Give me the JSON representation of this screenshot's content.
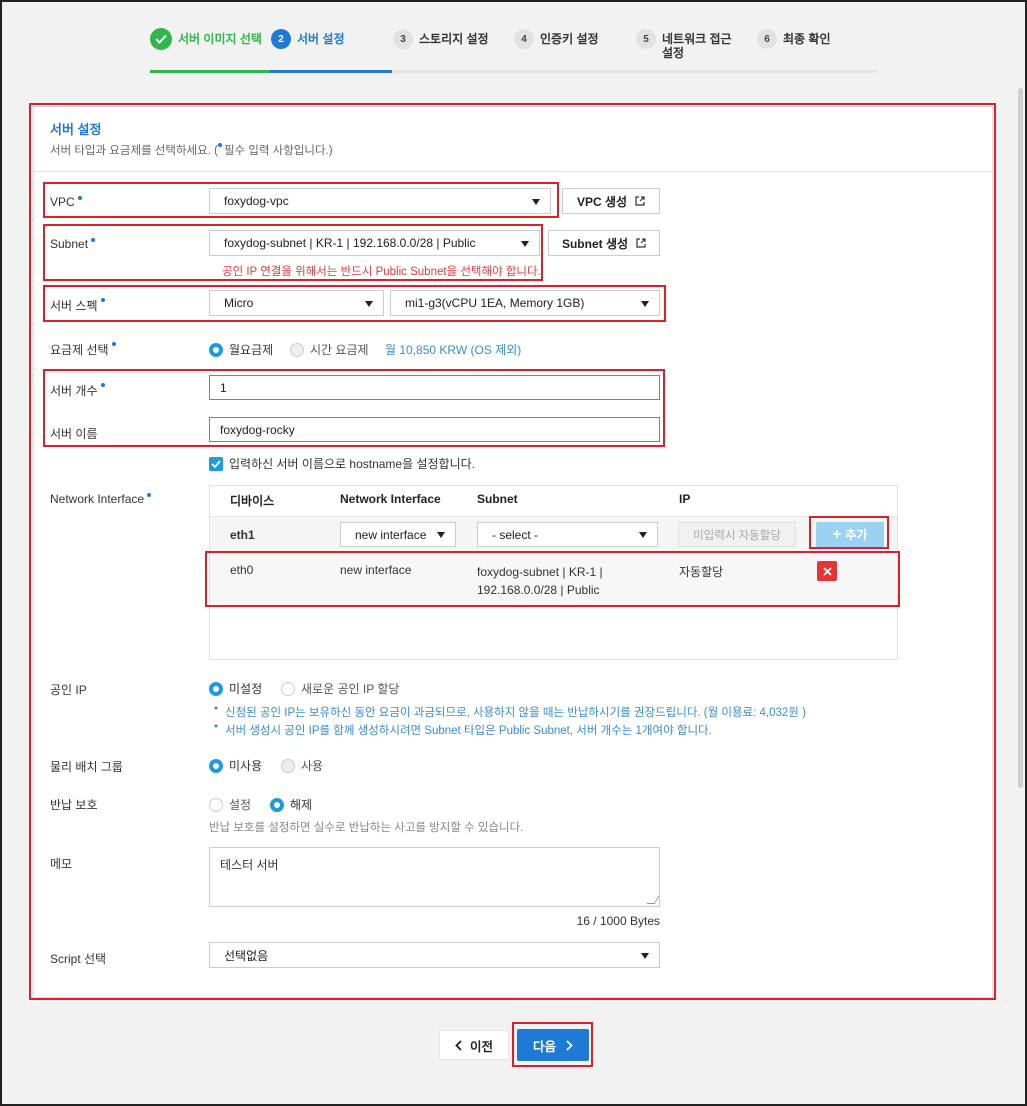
{
  "stepper": {
    "steps": [
      {
        "num": "",
        "label": "서버 이미지 선택"
      },
      {
        "num": "2",
        "label": "서버 설정"
      },
      {
        "num": "3",
        "label": "스토리지 설정"
      },
      {
        "num": "4",
        "label": "인증키 설정"
      },
      {
        "num": "5",
        "label": "네트워크 접근 설정"
      },
      {
        "num": "6",
        "label": "최종 확인"
      }
    ]
  },
  "panel": {
    "title": "서버 설정",
    "subtitle_prefix": "서버 타입과 요금제를 선택하세요. (",
    "subtitle_suffix": "필수 입력 사항입니다.)"
  },
  "vpc": {
    "label": "VPC",
    "value": "foxydog-vpc",
    "create_button": "VPC 생성"
  },
  "subnet": {
    "label": "Subnet",
    "value": "foxydog-subnet | KR-1 | 192.168.0.0/28 | Public",
    "create_button": "Subnet 생성",
    "warning": "공인 IP 연결을 위해서는 반드시 Public Subnet을 선택해야 합니다."
  },
  "spec": {
    "label": "서버 스펙",
    "type_value": "Micro",
    "spec_value": "mi1-g3(vCPU 1EA, Memory 1GB)"
  },
  "pricing": {
    "label": "요금제 선택",
    "monthly": "월요금제",
    "hourly": "시간 요금제",
    "price_note": "월 10,850 KRW (OS 제외)"
  },
  "server_count": {
    "label": "서버 개수",
    "value": "1"
  },
  "server_name": {
    "label": "서버 이름",
    "value": "foxydog-rocky",
    "hostname_check": "입력하신 서버 이름으로 hostname을 설정합니다."
  },
  "network_interface": {
    "label": "Network Interface",
    "headers": {
      "device": "디바이스",
      "ni": "Network Interface",
      "subnet": "Subnet",
      "ip": "IP"
    },
    "new_row": {
      "device": "eth1",
      "ni_select": "new interface",
      "subnet_select": "- select -",
      "ip_placeholder": "미입력시 자동할당",
      "add_button": "추가"
    },
    "rows": [
      {
        "device": "eth0",
        "ni": "new interface",
        "subnet_line1": "foxydog-subnet | KR-1 |",
        "subnet_line2": "192.168.0.0/28 | Public",
        "ip": "자동할당"
      }
    ]
  },
  "public_ip": {
    "label": "공인 IP",
    "option_off": "미설정",
    "option_new": "새로운 공인 IP 할당",
    "note1": "신청된 공인 IP는 보유하신 동안 요금이 과금되므로, 사용하지 않을 때는 반납하시기를 권장드립니다. (월 이용료: 4,032원 )",
    "note2": "서버 생성시 공인 IP를 함께 생성하시려면 Subnet 타입은 Public Subnet, 서버 개수는 1개여야 합니다."
  },
  "placement_group": {
    "label": "물리 배치 그룹",
    "option_off": "미사용",
    "option_on": "사용"
  },
  "return_protection": {
    "label": "반납 보호",
    "option_on": "설정",
    "option_off": "해제",
    "note": "반납 보호를 설정하면 실수로 반납하는 사고를 방지할 수 있습니다."
  },
  "memo": {
    "label": "메모",
    "value": "테스터 서버",
    "counter": "16 / 1000 Bytes"
  },
  "script": {
    "label": "Script 선택",
    "value": "선택없음"
  },
  "footer": {
    "prev": "이전",
    "next": "다음"
  },
  "colors": {
    "accent": "#1f7ad6",
    "success": "#2eb84b",
    "highlight": "#d9202c",
    "danger": "#e53535"
  }
}
